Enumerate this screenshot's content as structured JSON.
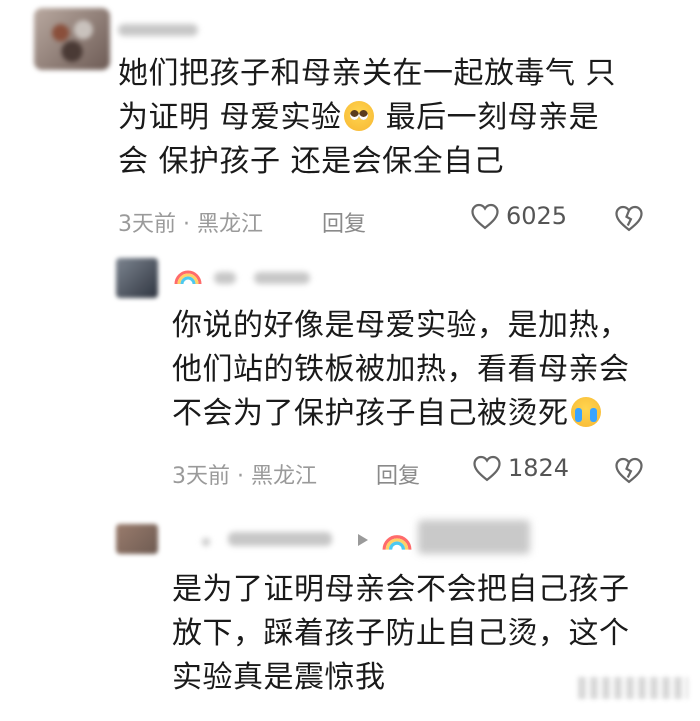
{
  "comments": [
    {
      "text_line1": "她们把孩子和母亲关在一起放毒气 只",
      "text_line2a": "为证明 母爱实验",
      "emoji_inline": "pleading-face",
      "text_line2b": " 最后一刻母亲是",
      "text_line3": "会 保护孩子 还是会保全自己",
      "meta": "3天前 · 黑龙江",
      "reply_label": "回复",
      "likes": "6025"
    },
    {
      "text_line1": "你说的好像是母爱实验，是加热，",
      "text_line2": "他们站的铁板被加热，看看母亲会",
      "text_line3": "不会为了保护孩子自己被烫死",
      "emoji_inline": "loudly-crying-face",
      "meta": "3天前 · 黑龙江",
      "reply_label": "回复",
      "likes": "1824"
    },
    {
      "text_line1": "是为了证明母亲会不会把自己孩子",
      "text_line2": "放下，踩着孩子防止自己烫，这个",
      "text_line3": "实验真是震惊我"
    }
  ],
  "icons": {
    "like": "heart-outline-icon",
    "dislike": "broken-heart-icon",
    "badge": "rainbow-icon",
    "reply_arrow": "play-arrow-icon"
  },
  "colors": {
    "meta": "#9a9a9a",
    "text": "#1a1a1a"
  }
}
